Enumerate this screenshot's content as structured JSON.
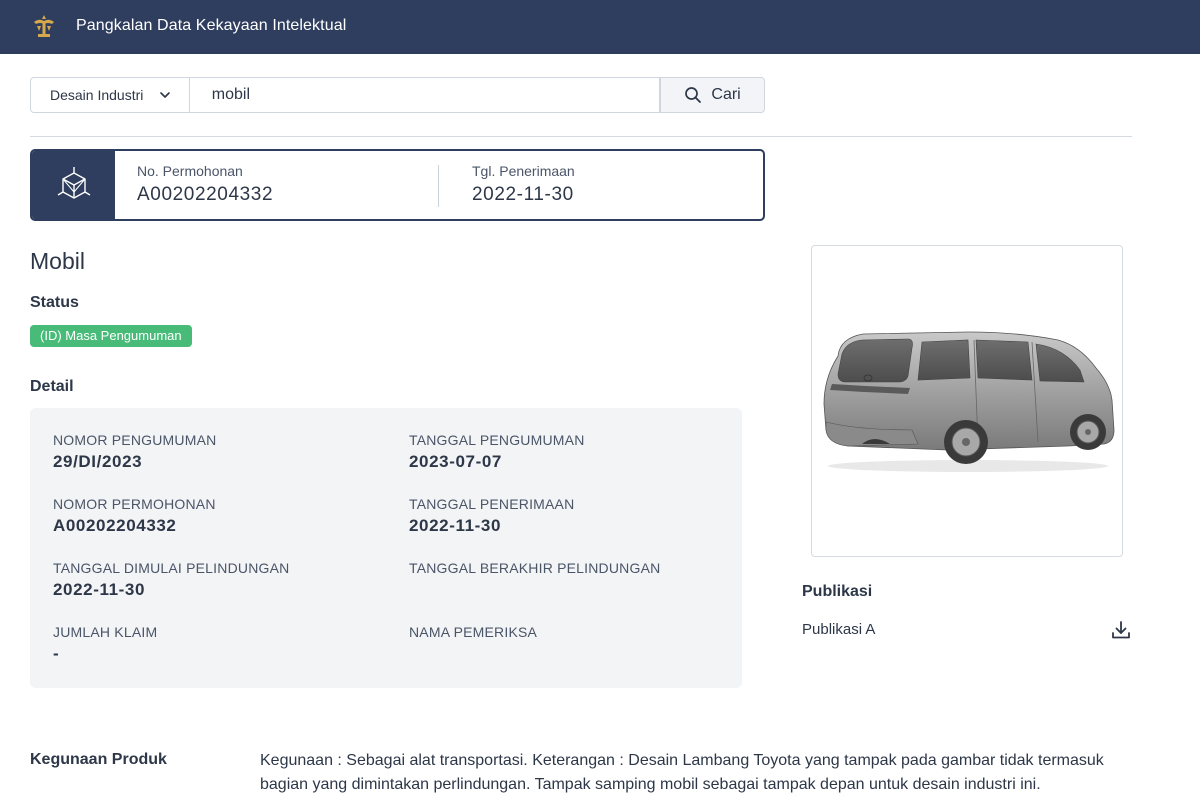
{
  "header": {
    "app_title": "Pangkalan Data Kekayaan Intelektual",
    "logo_icon": "emblem-logo-icon"
  },
  "search": {
    "category": "Desain Industri",
    "query": "mobil",
    "button_label": "Cari"
  },
  "application": {
    "number_label": "No. Permohonan",
    "number_value": "A00202204332",
    "date_label": "Tgl. Penerimaan",
    "date_value": "2022-11-30",
    "icon": "cube-icon"
  },
  "title": "Mobil",
  "status": {
    "heading": "Status",
    "badge": "(ID) Masa Pengumuman",
    "badge_color": "#48bb78"
  },
  "detail": {
    "heading": "Detail",
    "fields": [
      {
        "label": "NOMOR PENGUMUMAN",
        "value": "29/DI/2023"
      },
      {
        "label": "TANGGAL PENGUMUMAN",
        "value": "2023-07-07"
      },
      {
        "label": "NOMOR PERMOHONAN",
        "value": "A00202204332"
      },
      {
        "label": "TANGGAL PENERIMAAN",
        "value": "2022-11-30"
      },
      {
        "label": "TANGGAL DIMULAI PELINDUNGAN",
        "value": "2022-11-30"
      },
      {
        "label": "TANGGAL BERAKHIR PELINDUNGAN",
        "value": ""
      },
      {
        "label": "JUMLAH KLAIM",
        "value": "-"
      },
      {
        "label": "NAMA PEMERIKSA",
        "value": ""
      }
    ]
  },
  "publication": {
    "heading": "Publikasi",
    "items": [
      {
        "label": "Publikasi A",
        "icon": "download-icon"
      }
    ]
  },
  "usage": {
    "heading": "Kegunaan Produk",
    "text": "Kegunaan : Sebagai alat transportasi. Keterangan : Desain Lambang Toyota yang tampak pada gambar tidak termasuk bagian yang dimintakan perlindungan. Tampak samping mobil sebagai tampak depan untuk desain industri ini."
  },
  "colors": {
    "header_bg": "#2f3e5e",
    "accent": "#2f3e5e",
    "detail_bg": "#f3f4f6"
  }
}
